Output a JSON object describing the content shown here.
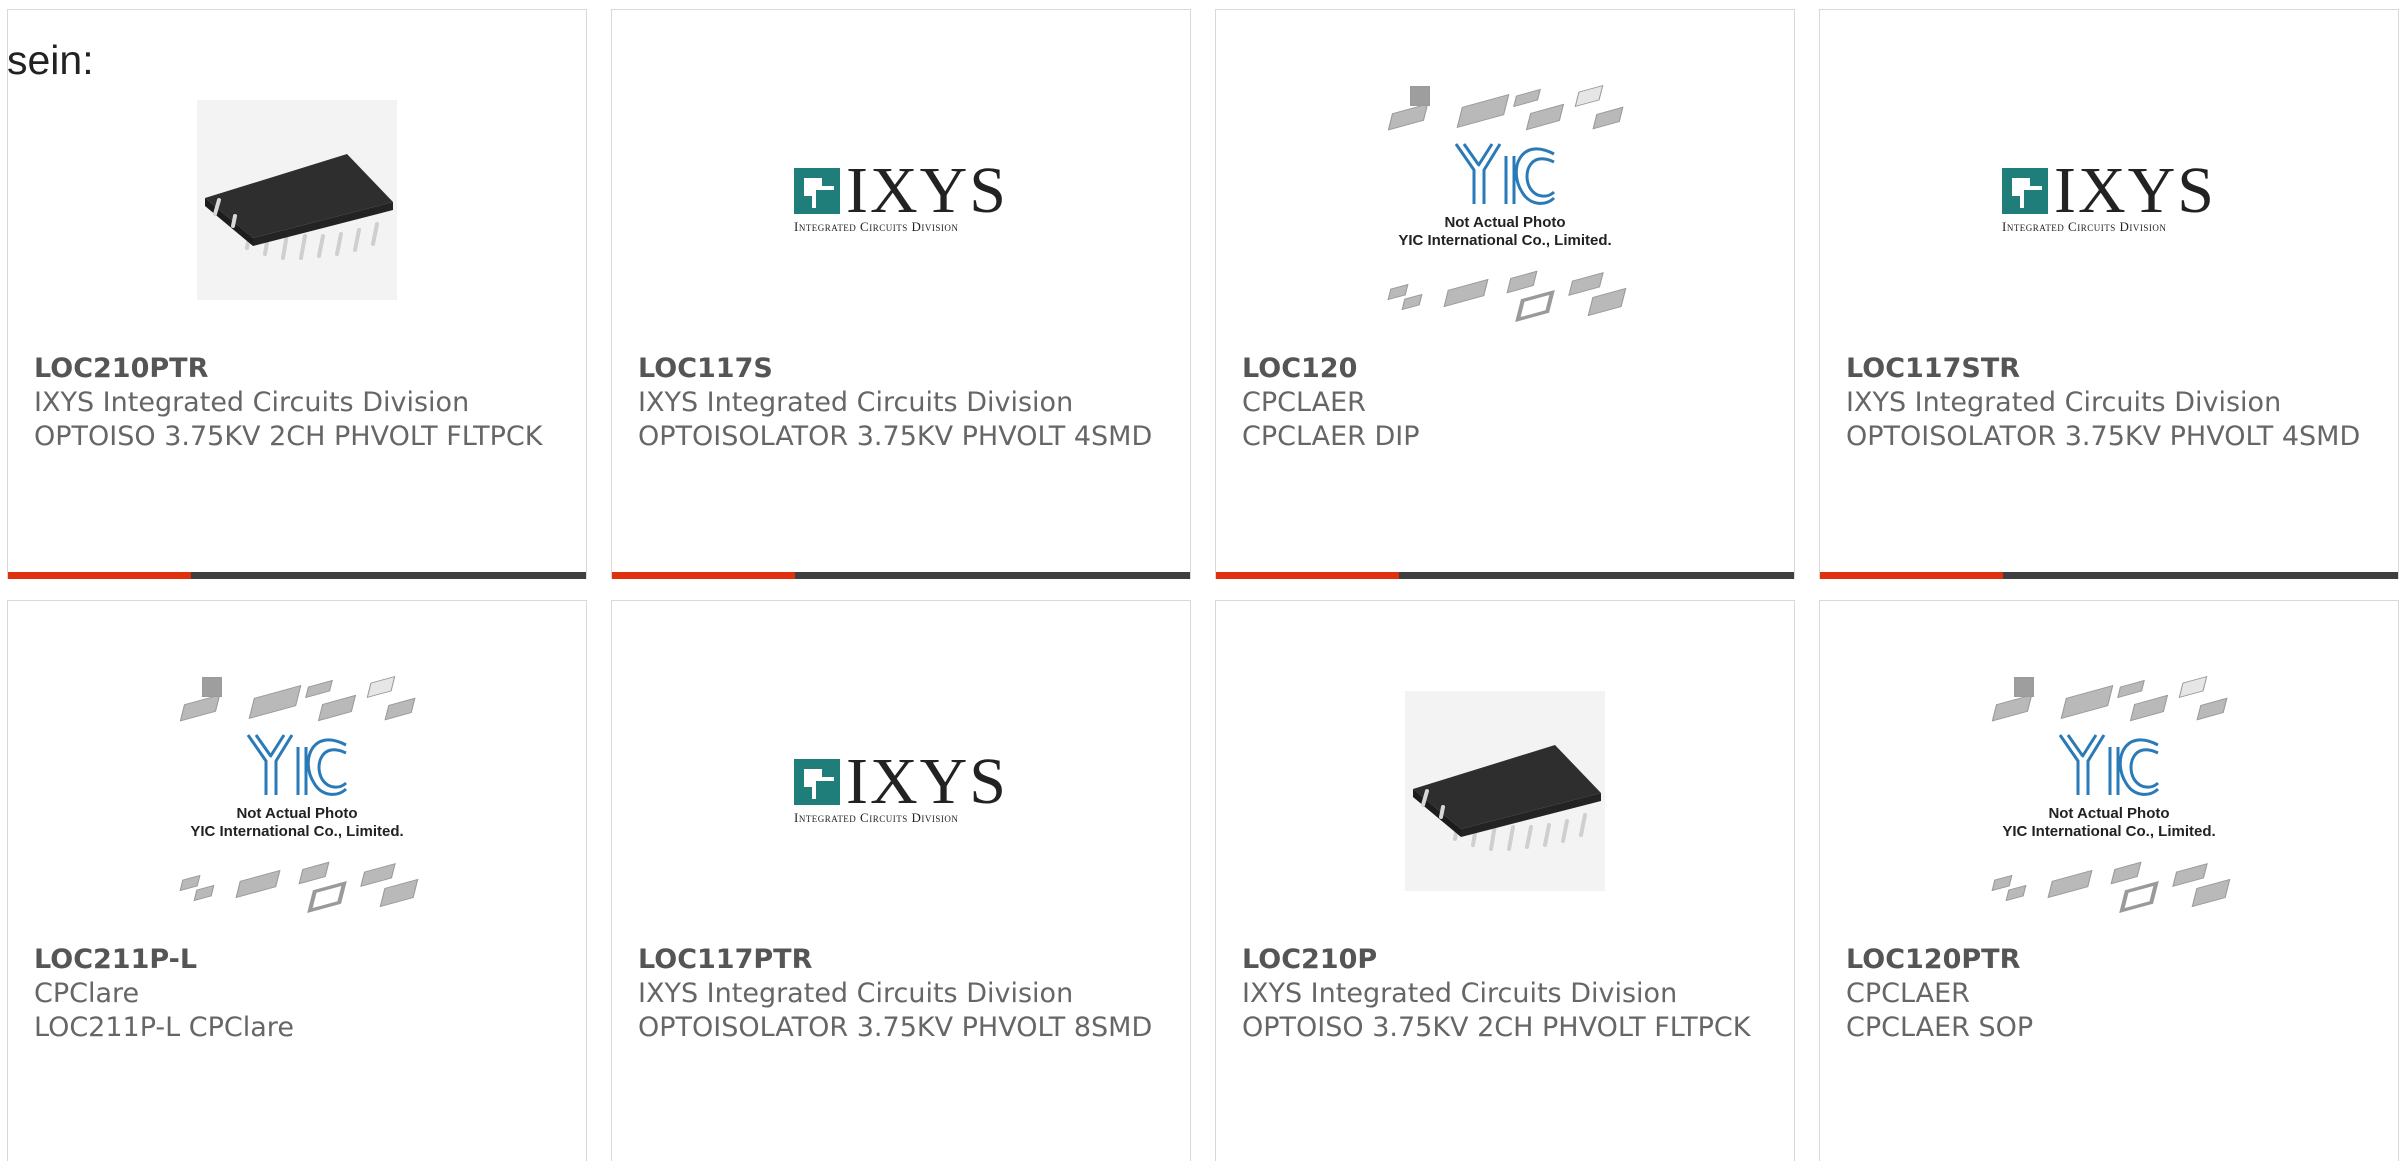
{
  "page": {
    "intro_text": "sein:"
  },
  "products": [
    {
      "part_number": "LOC210PTR",
      "manufacturer": "IXYS Integrated Circuits Division",
      "description": "OPTOISO 3.75KV 2CH PHVOLT FLTPCK",
      "image_type": "soic-chip-photo"
    },
    {
      "part_number": "LOC117S",
      "manufacturer": "IXYS Integrated Circuits Division",
      "description": "OPTOISOLATOR 3.75KV PHVOLT 4SMD",
      "image_type": "ixys-logo"
    },
    {
      "part_number": "LOC120",
      "manufacturer": "CPCLAER",
      "description": "CPCLAER DIP",
      "image_type": "yic-placeholder"
    },
    {
      "part_number": "LOC117STR",
      "manufacturer": "IXYS Integrated Circuits Division",
      "description": "OPTOISOLATOR 3.75KV PHVOLT 4SMD",
      "image_type": "ixys-logo"
    },
    {
      "part_number": "LOC211P-L",
      "manufacturer": "CPClare",
      "description": "LOC211P-L CPClare",
      "image_type": "yic-placeholder"
    },
    {
      "part_number": "LOC117PTR",
      "manufacturer": "IXYS Integrated Circuits Division",
      "description": "OPTOISOLATOR 3.75KV PHVOLT 8SMD",
      "image_type": "ixys-logo"
    },
    {
      "part_number": "LOC210P",
      "manufacturer": "IXYS Integrated Circuits Division",
      "description": "OPTOISO 3.75KV 2CH PHVOLT FLTPCK",
      "image_type": "soic-chip-photo"
    },
    {
      "part_number": "LOC120PTR",
      "manufacturer": "CPCLAER",
      "description": "CPCLAER SOP",
      "image_type": "yic-placeholder"
    }
  ],
  "logos": {
    "ixys_word": "IXYS",
    "ixys_sub": "Integrated Circuits Division",
    "yic_caption_line1": "Not Actual Photo",
    "yic_caption_line2": "YIC International Co., Limited."
  },
  "colors": {
    "accent": "#e0310f",
    "bar": "#3f3f3f",
    "ixys_teal": "#1f7d7a",
    "yic_blue": "#2a7ab8",
    "text": "#666666"
  }
}
